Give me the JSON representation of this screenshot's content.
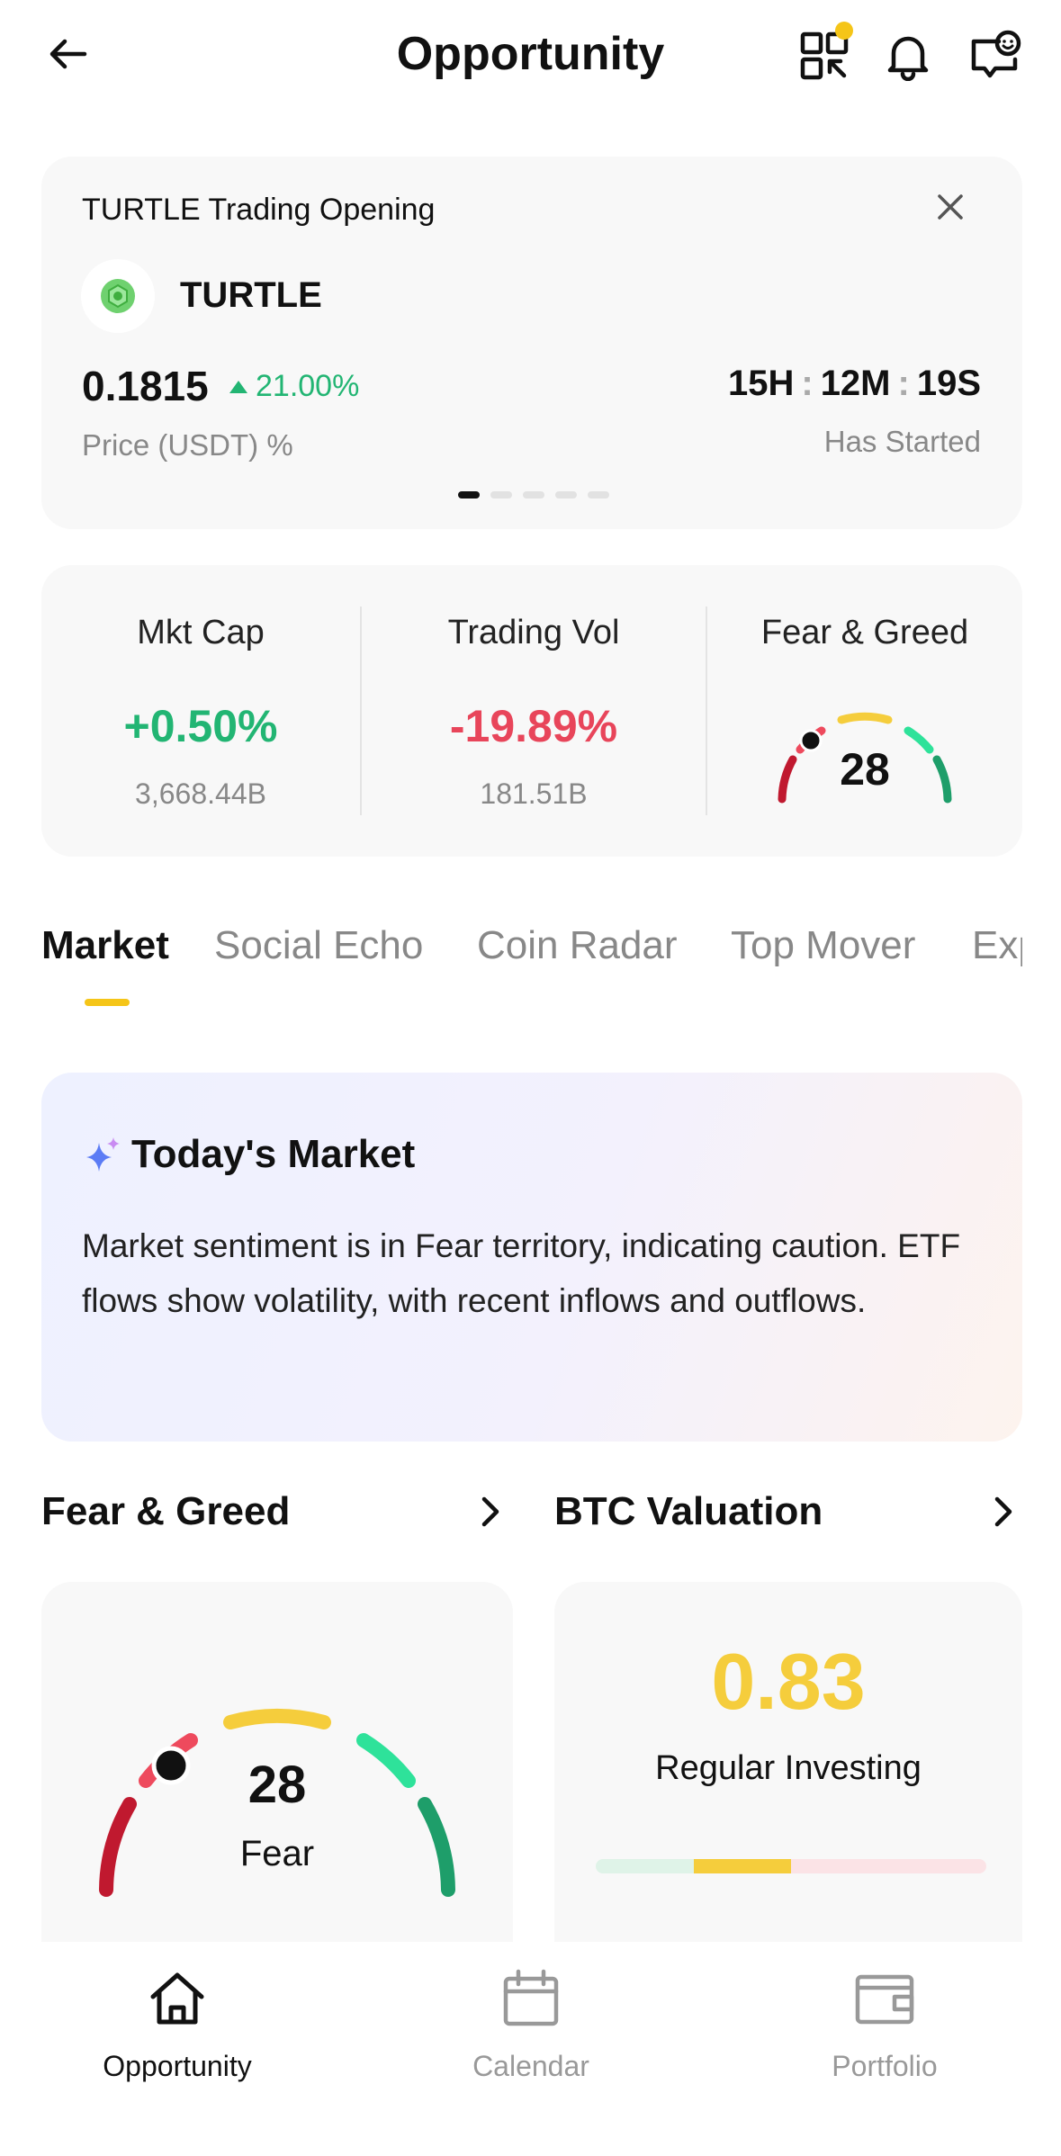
{
  "header": {
    "title": "Opportunity"
  },
  "banner": {
    "title": "TURTLE Trading Opening",
    "coin_name": "TURTLE",
    "price": "0.1815",
    "change": "21.00%",
    "price_label": "Price (USDT) %",
    "countdown": {
      "hours": "15H",
      "minutes": "12M",
      "seconds": "19S",
      "separator": ":"
    },
    "status": "Has Started",
    "carousel_active_index": 0,
    "carousel_count": 5
  },
  "metrics": {
    "mkt_cap": {
      "label": "Mkt Cap",
      "change": "+0.50%",
      "value": "3,668.44B"
    },
    "trading_vol": {
      "label": "Trading Vol",
      "change": "-19.89%",
      "value": "181.51B"
    },
    "fear_greed": {
      "label": "Fear & Greed",
      "value": "28"
    }
  },
  "tabs": [
    {
      "label": "Market",
      "active": true
    },
    {
      "label": "Social Echo",
      "active": false
    },
    {
      "label": "Coin Radar",
      "active": false
    },
    {
      "label": "Top Mover",
      "active": false
    },
    {
      "label": "Explore",
      "active": false
    }
  ],
  "today_market": {
    "title": "Today's Market",
    "body": "Market sentiment is in Fear territory, indicating caution. ETF flows show volatility, with recent inflows and outflows."
  },
  "sections": {
    "fear_greed_title": "Fear & Greed",
    "btc_valuation_title": "BTC Valuation"
  },
  "fear_greed_card": {
    "value": "28",
    "label": "Fear"
  },
  "btc_valuation_card": {
    "value": "0.83",
    "label": "Regular Investing"
  },
  "bottom_nav": [
    {
      "label": "Opportunity",
      "icon": "home-icon",
      "active": true
    },
    {
      "label": "Calendar",
      "icon": "calendar-icon",
      "active": false
    },
    {
      "label": "Portfolio",
      "icon": "wallet-icon",
      "active": false
    }
  ],
  "colors": {
    "positive": "#22b573",
    "negative": "#e8455a",
    "accent": "#f5c518",
    "fear_dark_red": "#c0192f",
    "fear_red": "#ee4a5d",
    "neutral_yellow": "#f5cd3c",
    "greed_green": "#2ee29a",
    "extreme_greed": "#1e9e6a"
  }
}
